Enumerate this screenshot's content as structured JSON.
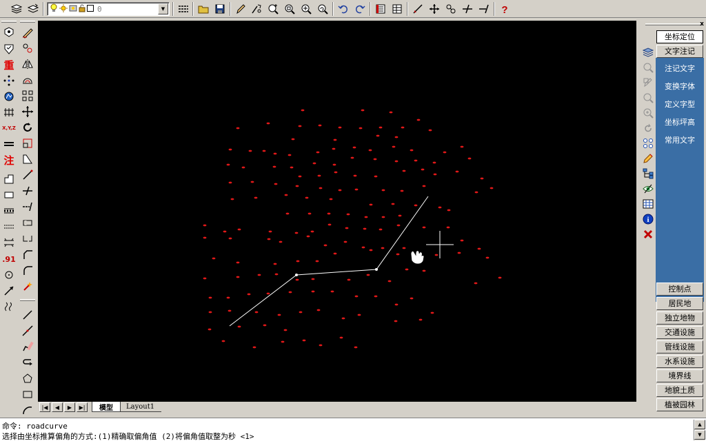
{
  "toolbar": {
    "layer_value": "0",
    "icons": [
      "layer-manager-icon",
      "layer-previous-icon",
      "lightbulb-icon",
      "sun-icon",
      "lock-icon",
      "layer-color-swatch-icon",
      "linetype-icon",
      "open-folder-icon",
      "save-disk-icon",
      "pencil-edit-icon",
      "redraw-icon",
      "zoom-realtime-icon",
      "zoom-window-icon",
      "zoom-extents-icon",
      "zoom-previous-icon",
      "undo-icon",
      "redo-icon",
      "properties-icon",
      "table-icon",
      "line-edit-icon",
      "move-cross-icon",
      "snap-icon",
      "trim-icon",
      "extend-icon",
      "help-icon"
    ]
  },
  "left_toolbar_a": {
    "labels": {
      "heavy": "重",
      "xyz": "X,Y,Z",
      "note": "注",
      "dot91": ".91"
    }
  },
  "tabs": {
    "model": "模型",
    "layout1": "Layout1"
  },
  "command": {
    "line1": "命令: roadcurve",
    "line2": "选择由坐标推算偏角的方式:(1)精确取偏角值  (2)将偏角值取整为秒  <1>"
  },
  "right_panel": {
    "top_buttons": [
      "坐标定位",
      "文字注记"
    ],
    "submenu": [
      "注记文字",
      "变换字体",
      "定义字型",
      "坐标坪高",
      "常用文字"
    ],
    "categories": [
      "控制点",
      "居民地",
      "独立地物",
      "交通设施",
      "管线设施",
      "水系设施",
      "境界线",
      "地貌土质",
      "植被园林"
    ],
    "close": "x"
  },
  "colors": {
    "canvas": "#000000",
    "points": "#e01818",
    "polyline": "#ffffff",
    "panel_blue": "#3a6ea5",
    "chrome": "#d4d0c8"
  }
}
